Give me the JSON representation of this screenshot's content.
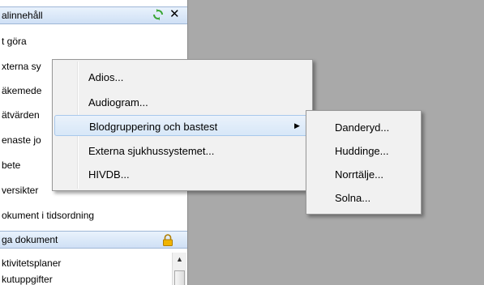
{
  "panel": {
    "title": "alinnehåll",
    "items": [
      "t göra",
      "xterna sy",
      "äkemede",
      "ätvärden",
      "enaste jo",
      "bete",
      "versikter",
      "okument i tidsordning"
    ]
  },
  "section": {
    "title": "ga dokument",
    "items": [
      "ktivitetsplaner",
      "kutuppgifter"
    ]
  },
  "context_menu": {
    "items": [
      "Adios...",
      "Audiogram...",
      "Blodgruppering och bastest",
      "Externa sjukhussystemet...",
      "HIVDB..."
    ],
    "submenu_arrow": "▶"
  },
  "submenu": {
    "items": [
      "Danderyd...",
      "Huddinge...",
      "Norrtälje...",
      "Solna..."
    ]
  },
  "scrollbar": {
    "up_arrow": "▲"
  },
  "icons": {
    "close": "✕"
  },
  "colors": {
    "highlight": "#d7e7f8",
    "lock": "#f0b400",
    "refresh": "#3aa635"
  }
}
